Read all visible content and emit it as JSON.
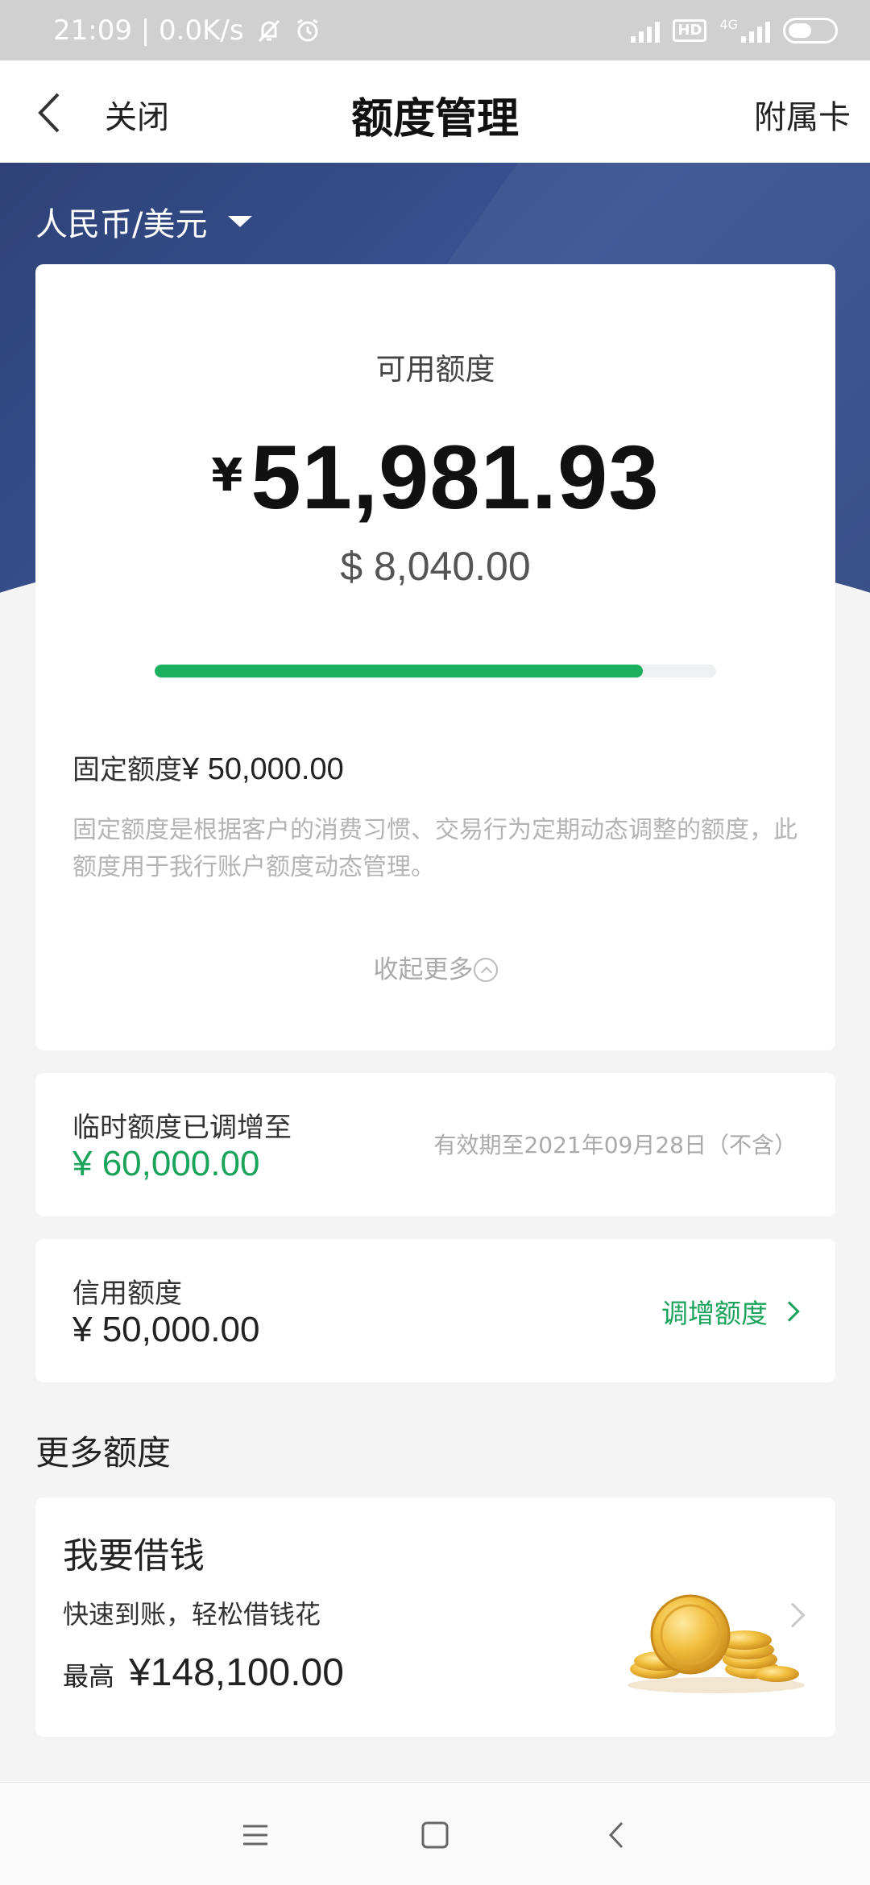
{
  "status_bar": {
    "left_text": "21:09 | 0.0K/s",
    "hd": "HD",
    "network": "4G",
    "icons": [
      "bell-off-icon",
      "alarm-icon",
      "signal-icon",
      "hd-icon",
      "signal-4g-icon",
      "battery-icon"
    ]
  },
  "nav": {
    "back_icon": "back-arrow-icon",
    "close_label": "关闭",
    "title": "额度管理",
    "right_label": "附属卡"
  },
  "currency_selector": {
    "label": "人民币/美元",
    "icon": "caret-down-icon"
  },
  "available": {
    "label": "可用额度",
    "currency_symbol": "¥",
    "amount": "51,981.93",
    "usd": "$ 8,040.00",
    "progress_fraction": 0.87,
    "progress_color": "#1bb05d"
  },
  "fixed": {
    "label": "固定额度",
    "amount": "¥ 50,000.00",
    "description": "固定额度是根据客户的消费习惯、交易行为定期动态调整的额度，此额度用于我行账户额度动态管理。",
    "collapse_label": "收起更多"
  },
  "temporary": {
    "label": "临时额度已调增至",
    "amount": "¥ 60,000.00",
    "valid_until": "有效期至2021年09月28日（不含）",
    "amount_color": "#1aa35a"
  },
  "credit": {
    "label": "信用额度",
    "amount": "¥ 50,000.00",
    "raise_label": "调增额度"
  },
  "more": {
    "title": "更多额度"
  },
  "loan": {
    "title": "我要借钱",
    "subtitle": "快速到账，轻松借钱花",
    "max_label": "最高",
    "max_amount": "¥148,100.00",
    "image_icon": "gold-coins-icon"
  },
  "system_nav": {
    "icons": [
      "menu-icon",
      "home-square-icon",
      "back-icon"
    ]
  },
  "colors": {
    "header_blue": "#34498a",
    "accent_green": "#1aa35a"
  }
}
